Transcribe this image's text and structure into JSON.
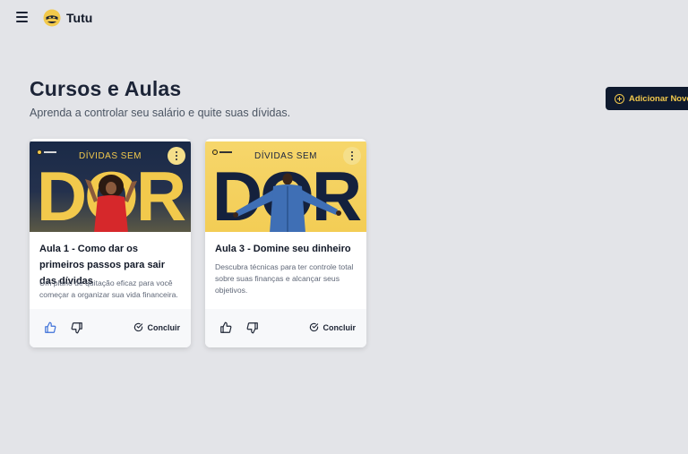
{
  "app": {
    "name": "Tutu"
  },
  "header": {
    "title": "Cursos e Aulas",
    "subtitle": "Aprenda a controlar seu salário e quite suas dívidas.",
    "add_button_label": "Adicionar Novo C"
  },
  "cards": [
    {
      "thumbnail_heading": "DÍVIDAS SEM",
      "thumbnail_word": "DOR",
      "title": "Aula 1 - Como dar os primeiros passos para sair das dívidas",
      "description": "Um plano de quitação eficaz para você começar a organizar sua vida financeira.",
      "conclude_label": "Concluir"
    },
    {
      "thumbnail_heading": "DÍVIDAS SEM",
      "thumbnail_word": "DOR",
      "title": "Aula 3 - Domine seu dinheiro",
      "description": "Descubra técnicas para ter controle total sobre suas finanças e alcançar seus objetivos.",
      "conclude_label": "Concluir"
    }
  ],
  "colors": {
    "background": "#e3e4e8",
    "accent": "#f2c94c",
    "primary_dark": "#0f1a2e",
    "like_icon": "#3b6fd8"
  },
  "icons": {
    "menu": "hamburger-icon",
    "logo": "ninja-logo-icon",
    "add": "plus-circle-icon",
    "more": "more-vertical-icon",
    "like": "thumbs-up-icon",
    "dislike": "thumbs-down-icon",
    "conclude": "check-circle-icon"
  }
}
